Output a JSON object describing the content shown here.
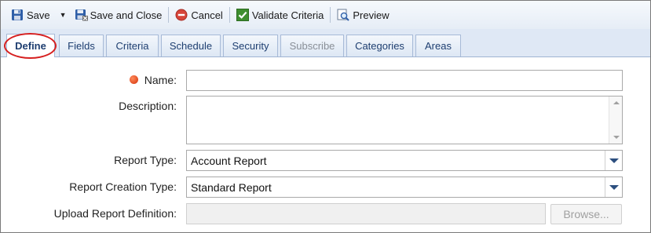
{
  "toolbar": {
    "save_label": "Save",
    "save_close_label": "Save and Close",
    "cancel_label": "Cancel",
    "validate_label": "Validate Criteria",
    "preview_label": "Preview"
  },
  "tabs": [
    {
      "label": "Define",
      "active": true
    },
    {
      "label": "Fields"
    },
    {
      "label": "Criteria"
    },
    {
      "label": "Schedule"
    },
    {
      "label": "Security"
    },
    {
      "label": "Subscribe",
      "disabled": true
    },
    {
      "label": "Categories"
    },
    {
      "label": "Areas"
    }
  ],
  "form": {
    "name_label": "Name:",
    "name_value": "",
    "description_label": "Description:",
    "description_value": "",
    "report_type_label": "Report Type:",
    "report_type_value": "Account Report",
    "creation_type_label": "Report Creation Type:",
    "creation_type_value": "Standard Report",
    "upload_label": "Upload Report Definition:",
    "upload_value": "",
    "browse_label": "Browse..."
  },
  "colors": {
    "required_indicator": "#e0481a",
    "highlight_ring": "#d62020",
    "tab_text": "#1e3e70"
  }
}
